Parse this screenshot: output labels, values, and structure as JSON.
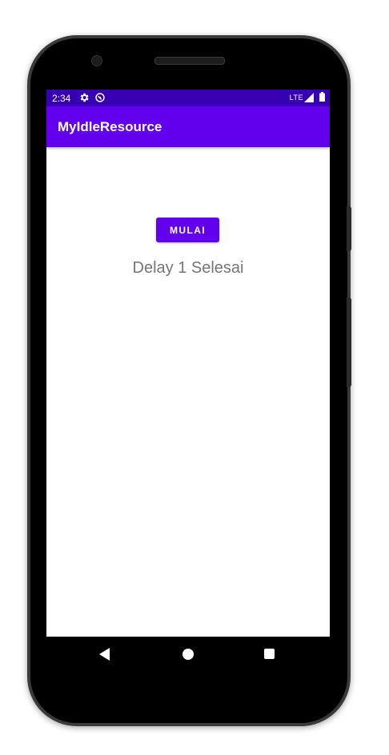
{
  "status_bar": {
    "time": "2:34",
    "network": "LTE",
    "icons": [
      "settings-gear-icon",
      "data-saver-icon",
      "signal-icon",
      "battery-icon"
    ]
  },
  "app_bar": {
    "title": "MyIdleResource"
  },
  "main": {
    "start_button_label": "MULAI",
    "status_text": "Delay 1 Selesai"
  },
  "nav_bar": {
    "icons": [
      "back-icon",
      "home-icon",
      "recents-icon"
    ]
  },
  "colors": {
    "primary": "#6200EE",
    "primary_dark": "#3700B3",
    "text_secondary": "#757575"
  }
}
